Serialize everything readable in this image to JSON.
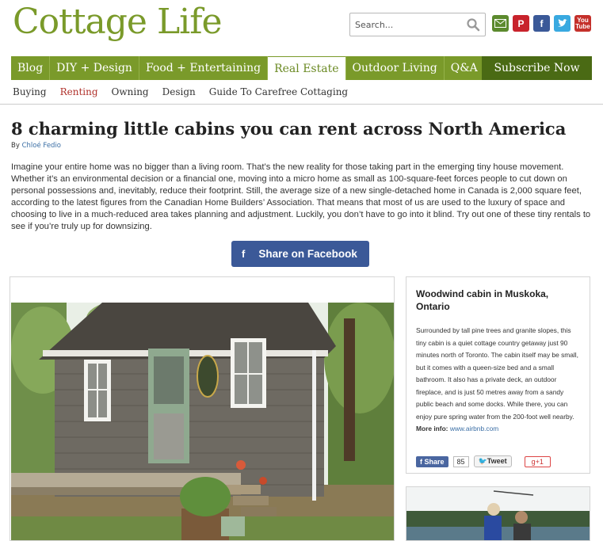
{
  "header": {
    "logo": "Cottage Life",
    "search_placeholder": "Search...",
    "social": [
      "mail-icon",
      "pinterest-icon",
      "facebook-icon",
      "twitter-icon",
      "youtube-icon"
    ],
    "youtube_label": "You Tube"
  },
  "nav": {
    "items": [
      {
        "label": "Blog"
      },
      {
        "label": "DIY + Design"
      },
      {
        "label": "Food + Entertaining"
      },
      {
        "label": "Real Estate"
      },
      {
        "label": "Outdoor Living"
      },
      {
        "label": "Q&A"
      }
    ],
    "active": "Real Estate",
    "subscribe": "Subscribe Now"
  },
  "subnav": {
    "items": [
      {
        "label": "Buying"
      },
      {
        "label": "Renting"
      },
      {
        "label": "Owning"
      },
      {
        "label": "Design"
      },
      {
        "label": "Guide To Carefree Cottaging"
      }
    ],
    "active": "Renting"
  },
  "article": {
    "title": "8 charming little cabins you can rent across North America",
    "by": "By",
    "author": "Chloé Fedio",
    "intro": "Imagine your entire home was no bigger than a living room. That’s the new reality for those taking part in the emerging tiny house movement. Whether it’s an environmental decision or a financial one, moving into a micro home as small as 100-square-feet forces people to cut down on personal possessions and, inevitably, reduce their footprint. Still, the average size of a new single-detached home in Canada is 2,000 square feet, according to the latest figures from the Canadian Home Builders’ Association. That means that most of us are used to the luxury of space and choosing to live in a much-reduced area takes planning and adjustment. Luckily, you don’t have to go into it blind. Try out one of these tiny rentals to see if you’re truly up for downsizing.",
    "share_button": "Share on Facebook",
    "fb_letter": "f"
  },
  "card": {
    "title": "Woodwind cabin in Muskoka, Ontario",
    "body": "Surrounded by tall pine trees and granite slopes, this tiny cabin is a quiet cottage country getaway just 90 minutes north of Toronto. The cabin itself may be small, but it comes with a queen-size bed and a small bathroom. It also has a private deck, an outdoor fireplace, and is just 50 metres away from a sandy public beach and some docks. While there, you can enjoy pure spring water from the 200-foot well nearby.",
    "more_label": "More info:",
    "more_link": "www.airbnb.com",
    "share_label": "Share",
    "share_count": "85",
    "tweet_label": "Tweet",
    "gplus_label": "+1"
  }
}
